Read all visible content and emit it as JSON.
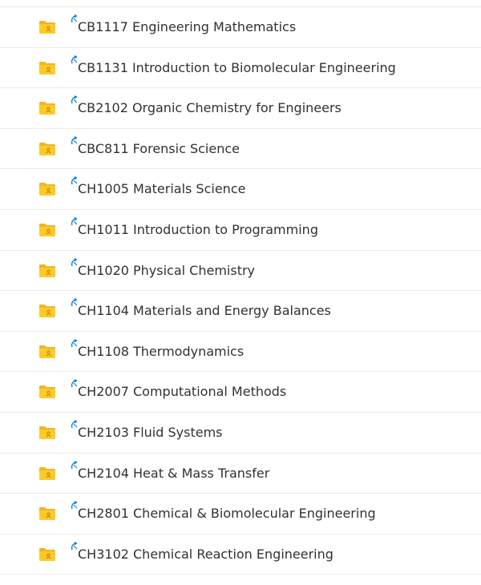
{
  "file_list": {
    "items": [
      {
        "name": "CB1117 Engineering Mathematics",
        "icon": "shared-folder-icon",
        "status_icon": "sync-pending-icon"
      },
      {
        "name": "CB1131 Introduction to Biomolecular Engineering",
        "icon": "shared-folder-icon",
        "status_icon": "sync-pending-icon"
      },
      {
        "name": "CB2102 Organic Chemistry for Engineers",
        "icon": "shared-folder-icon",
        "status_icon": "sync-pending-icon"
      },
      {
        "name": "CBC811 Forensic Science",
        "icon": "shared-folder-icon",
        "status_icon": "sync-pending-icon"
      },
      {
        "name": "CH1005 Materials Science",
        "icon": "shared-folder-icon",
        "status_icon": "sync-pending-icon"
      },
      {
        "name": "CH1011 Introduction to Programming",
        "icon": "shared-folder-icon",
        "status_icon": "sync-pending-icon"
      },
      {
        "name": "CH1020 Physical Chemistry",
        "icon": "shared-folder-icon",
        "status_icon": "sync-pending-icon"
      },
      {
        "name": "CH1104 Materials and Energy Balances",
        "icon": "shared-folder-icon",
        "status_icon": "sync-pending-icon"
      },
      {
        "name": "CH1108 Thermodynamics",
        "icon": "shared-folder-icon",
        "status_icon": "sync-pending-icon"
      },
      {
        "name": "CH2007 Computational Methods",
        "icon": "shared-folder-icon",
        "status_icon": "sync-pending-icon"
      },
      {
        "name": "CH2103 Fluid Systems",
        "icon": "shared-folder-icon",
        "status_icon": "sync-pending-icon"
      },
      {
        "name": "CH2104 Heat & Mass Transfer",
        "icon": "shared-folder-icon",
        "status_icon": "sync-pending-icon"
      },
      {
        "name": "CH2801 Chemical & Biomolecular Engineering",
        "icon": "shared-folder-icon",
        "status_icon": "sync-pending-icon"
      },
      {
        "name": "CH3102 Chemical Reaction Engineering",
        "icon": "shared-folder-icon",
        "status_icon": "sync-pending-icon"
      }
    ]
  },
  "colors": {
    "folder_body": "#ffca28",
    "folder_back": "#f0b429",
    "sync_accent": "#0078d4",
    "text": "#323130",
    "divider": "#edebe9"
  }
}
